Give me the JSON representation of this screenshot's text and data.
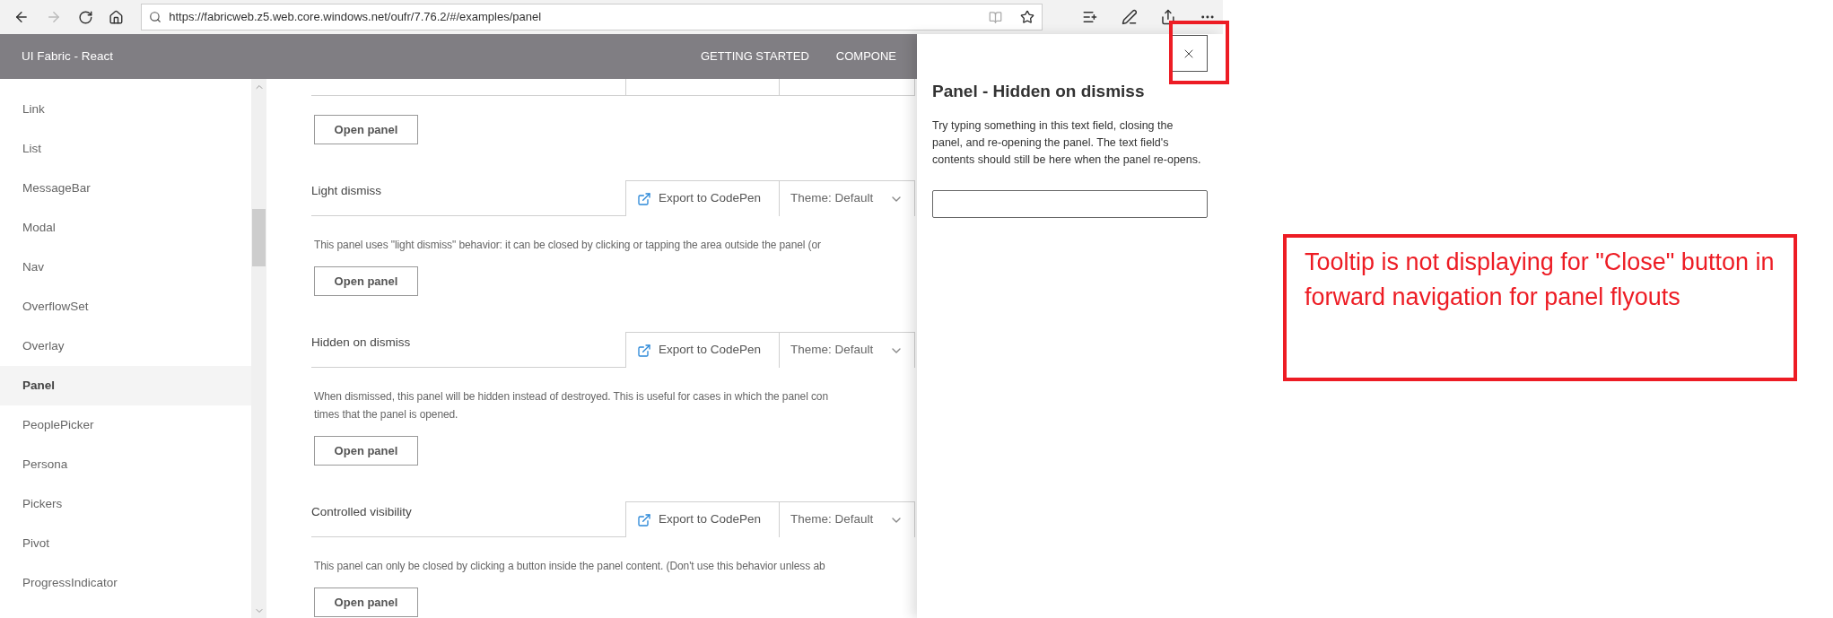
{
  "browser": {
    "url": "https://fabricweb.z5.web.core.windows.net/oufr/7.76.2/#/examples/panel",
    "forward_disabled": true
  },
  "header": {
    "brand": "UI Fabric - React",
    "nav": [
      "GETTING STARTED",
      "COMPONE"
    ]
  },
  "sidebar": {
    "items": [
      {
        "label": "Link",
        "selected": false
      },
      {
        "label": "List",
        "selected": false
      },
      {
        "label": "MessageBar",
        "selected": false
      },
      {
        "label": "Modal",
        "selected": false
      },
      {
        "label": "Nav",
        "selected": false
      },
      {
        "label": "OverflowSet",
        "selected": false
      },
      {
        "label": "Overlay",
        "selected": false
      },
      {
        "label": "Panel",
        "selected": true
      },
      {
        "label": "PeoplePicker",
        "selected": false
      },
      {
        "label": "Persona",
        "selected": false
      },
      {
        "label": "Pickers",
        "selected": false
      },
      {
        "label": "Pivot",
        "selected": false
      },
      {
        "label": "ProgressIndicator",
        "selected": false
      }
    ]
  },
  "sections": [
    {
      "button": "Open panel"
    },
    {
      "title": "Light dismiss",
      "export": "Export to CodePen",
      "theme": "Theme: Default",
      "description": [
        "This panel uses \"light dismiss\" behavior: it can be closed by clicking or tapping the area outside the panel (or"
      ],
      "button": "Open panel"
    },
    {
      "title": "Hidden on dismiss",
      "export": "Export to CodePen",
      "theme": "Theme: Default",
      "description": [
        "When dismissed, this panel will be hidden instead of destroyed. This is useful for cases in which the panel con",
        "times that the panel is opened."
      ],
      "button": "Open panel"
    },
    {
      "title": "Controlled visibility",
      "export": "Export to CodePen",
      "theme": "Theme: Default",
      "description": [
        "This panel can only be closed by clicking a button inside the panel content. (Don't use this behavior unless ab"
      ],
      "button": "Open panel"
    }
  ],
  "panel": {
    "title": "Panel - Hidden on dismiss",
    "description": "Try typing something in this text field, closing the panel, and re-opening the panel. The text field's contents should still be here when the panel re-opens."
  },
  "annotation": {
    "text": "Tooltip is not displaying for \"Close\" button in forward navigation for panel flyouts"
  }
}
